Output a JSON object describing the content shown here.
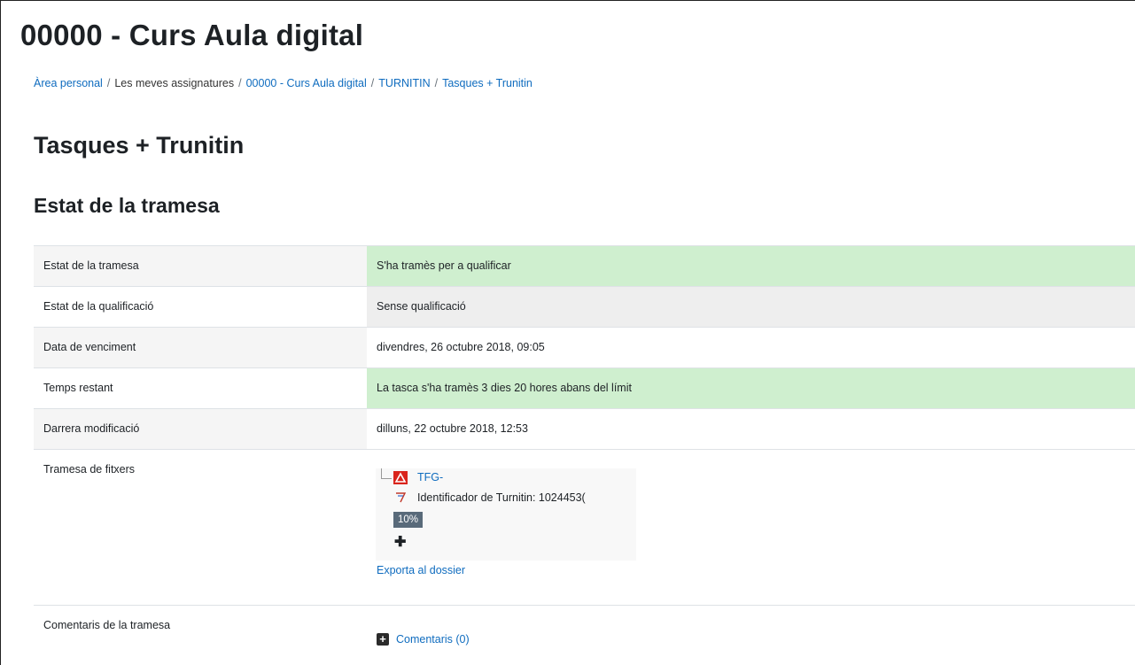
{
  "course": {
    "title": "00000 - Curs Aula digital"
  },
  "breadcrumb": [
    {
      "label": "Àrea personal",
      "link": true
    },
    {
      "label": "Les meves assignatures",
      "link": false
    },
    {
      "label": "00000 - Curs Aula digital",
      "link": true
    },
    {
      "label": "TURNITIN",
      "link": true
    },
    {
      "label": "Tasques + Trunitin",
      "link": true
    }
  ],
  "activity": {
    "title": "Tasques + Trunitin"
  },
  "submission": {
    "heading": "Estat de la tramesa",
    "rows": {
      "status": {
        "label": "Estat de la tramesa",
        "value": "S'ha tramès per a qualificar"
      },
      "grading": {
        "label": "Estat de la qualificació",
        "value": "Sense qualificació"
      },
      "due": {
        "label": "Data de venciment",
        "value": "divendres, 26 octubre 2018, 09:05"
      },
      "remaining": {
        "label": "Temps restant",
        "value": "La tasca s'ha tramès 3 dies 20 hores abans del límit"
      },
      "modified": {
        "label": "Darrera modificació",
        "value": "dilluns, 22 octubre 2018, 12:53"
      },
      "files": {
        "label": "Tramesa de fitxers",
        "file_name": "TFG-",
        "turnitin_id": "Identificador de Turnitin: 1024453(",
        "similarity": "10%",
        "export_label": "Exporta al dossier"
      },
      "comments": {
        "label": "Comentaris de la tramesa",
        "link_label": "Comentaris (0)"
      }
    }
  },
  "colors": {
    "link": "#0f6cbf",
    "submitted_bg": "#cfefcf",
    "badge_bg": "#596a7a"
  },
  "icons": {
    "file": "pdf-icon",
    "turnitin": "turnitin-icon",
    "expand": "plus-icon",
    "comments": "plus-square-icon"
  }
}
